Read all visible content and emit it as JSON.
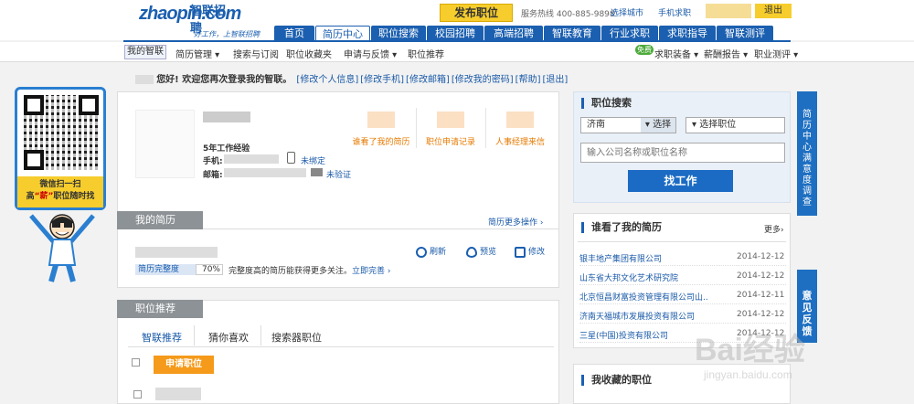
{
  "header": {
    "logo_text": "zhaopin.com",
    "logo_cn": "智联招聘",
    "slogan": "好工作，上智联招聘",
    "post_job": "发布职位",
    "hotline": "服务热线 400-885-9898",
    "select_city": "选择城市",
    "mobile": "手机求职",
    "logout": "退出"
  },
  "mainnav": [
    {
      "label": "首页"
    },
    {
      "label": "简历中心"
    },
    {
      "label": "职位搜索"
    },
    {
      "label": "校园招聘"
    },
    {
      "label": "高端招聘"
    },
    {
      "label": "智联教育"
    },
    {
      "label": "行业求职"
    },
    {
      "label": "求职指导"
    },
    {
      "label": "智联测评"
    }
  ],
  "subnav": [
    {
      "label": "我的智联"
    },
    {
      "label": "简历管理 ▾"
    },
    {
      "label": "搜索与订阅"
    },
    {
      "label": "职位收藏夹"
    },
    {
      "label": "申请与反馈 ▾"
    },
    {
      "label": "职位推荐"
    },
    {
      "label": "求职装备 ▾"
    },
    {
      "label": "薪酬报告 ▾"
    },
    {
      "label": "职业测评 ▾"
    }
  ],
  "free_badge": "免费",
  "greeting": {
    "welcome": "您好! 欢迎您再次登录我的智联。",
    "links": [
      "[修改个人信息]",
      "[修改手机]",
      "[修改邮箱]",
      "[修改我的密码]",
      "[帮助]",
      "[退出]"
    ]
  },
  "qr": {
    "line1": "微信扫一扫",
    "line2_pre": "高",
    "line2_hl": "“薪”",
    "line2_post": "职位随时找"
  },
  "profile": {
    "experience": "5年工作经验",
    "phone_label": "手机:",
    "email_label": "邮箱:",
    "phone_status": "未绑定",
    "email_status": "未验证",
    "stats": [
      "谁看了我的简历",
      "职位申请记录",
      "人事经理来信"
    ]
  },
  "resume": {
    "title": "我的简历",
    "more": "简历更多操作 ›",
    "refresh": "刷新",
    "preview": "预览",
    "edit": "修改",
    "complete_label": "简历完整度",
    "complete_pct": "70%",
    "complete_value": 0.7,
    "tip": "完整度高的简历能获得更多关注。",
    "tip_link": "立即完善 ›"
  },
  "rec": {
    "title": "职位推荐",
    "tabs": [
      "智联推荐",
      "猜你喜欢",
      "搜索器职位"
    ],
    "apply": "申请职位"
  },
  "search": {
    "title": "职位搜索",
    "city": "济南",
    "city_btn": "▾ 选择",
    "job": "▾ 选择职位",
    "placeholder": "输入公司名称或职位名称",
    "find": "找工作"
  },
  "viewed": {
    "title": "谁看了我的简历",
    "more": "更多›",
    "rows": [
      {
        "company": "银丰地产集团有限公司",
        "date": "2014-12-12"
      },
      {
        "company": "山东省大邦文化艺术研究院",
        "date": "2014-12-12"
      },
      {
        "company": "北京恒昌财富投资管理有限公司山...",
        "date": "2014-12-11"
      },
      {
        "company": "济南天福城市发展投资有限公司",
        "date": "2014-12-12"
      },
      {
        "company": "三星(中国)投资有限公司",
        "date": "2014-12-12"
      }
    ]
  },
  "favorites": {
    "title": "我收藏的职位"
  },
  "side": {
    "survey": "简历中心满意度调查",
    "feedback": "意见反馈"
  },
  "watermark": {
    "main": "Bai经验",
    "sub": "jingyan.baidu.com"
  },
  "colors": {
    "brand": "#1b5fb0",
    "accent": "#f6cd2c",
    "orange": "#f59a1a"
  }
}
